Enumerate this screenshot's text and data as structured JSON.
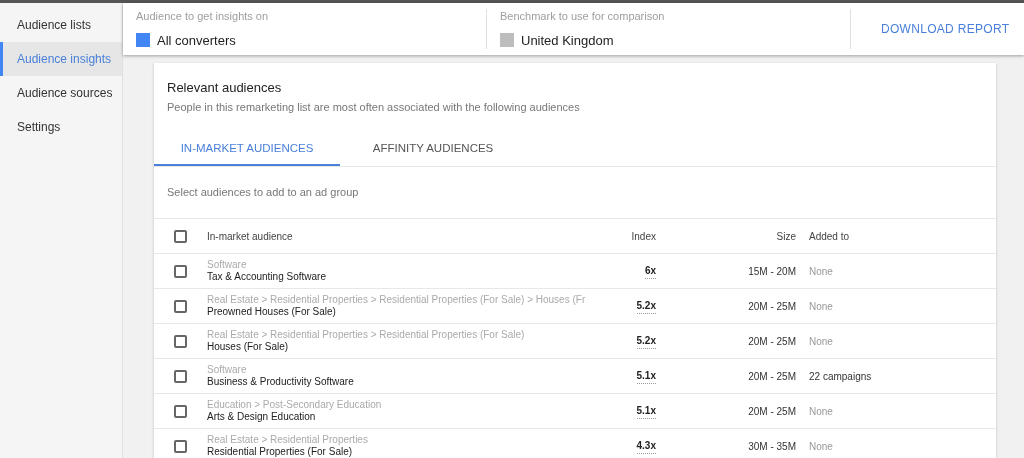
{
  "sidebar": {
    "items": [
      {
        "label": "Audience lists",
        "selected": false
      },
      {
        "label": "Audience insights",
        "selected": true
      },
      {
        "label": "Audience sources",
        "selected": false
      },
      {
        "label": "Settings",
        "selected": false
      }
    ]
  },
  "top_bar": {
    "fields": [
      {
        "label": "Audience to get insights on",
        "value": "All converters",
        "color": "#4285f4"
      },
      {
        "label": "Benchmark to use for comparison",
        "value": "United Kingdom",
        "color": "#bdbdbd"
      }
    ],
    "action": "DOWNLOAD REPORT"
  },
  "card": {
    "title": "Relevant audiences",
    "subtitle": "People in this remarketing list are most often associated with the following audiences",
    "tabs": [
      {
        "label": "IN-MARKET AUDIENCES",
        "selected": true
      },
      {
        "label": "AFFINITY AUDIENCES",
        "selected": false
      }
    ],
    "hint": "Select audiences to add to an ad group",
    "table": {
      "header_checked": false,
      "columns": [
        "In-market audience",
        "Index",
        "Size",
        "Added to"
      ],
      "rows": [
        {
          "checked": false,
          "path": "Software",
          "name": "Tax & Accounting Software",
          "index": "6x",
          "size": "15M - 20M",
          "added_to": "None",
          "added_muted": true
        },
        {
          "checked": false,
          "path": "Real Estate > Residential Properties > Residential Properties (For Sale) > Houses (Fr",
          "name": "Preowned Houses (For Sale)",
          "index": "5.2x",
          "size": "20M - 25M",
          "added_to": "None",
          "added_muted": true
        },
        {
          "checked": false,
          "path": "Real Estate > Residential Properties > Residential Properties (For Sale)",
          "name": "Houses (For Sale)",
          "index": "5.2x",
          "size": "20M - 25M",
          "added_to": "None",
          "added_muted": true
        },
        {
          "checked": false,
          "path": "Software",
          "name": "Business & Productivity Software",
          "index": "5.1x",
          "size": "20M - 25M",
          "added_to": "22 campaigns",
          "added_muted": false
        },
        {
          "checked": false,
          "path": "Education > Post-Secondary Education",
          "name": "Arts & Design Education",
          "index": "5.1x",
          "size": "20M - 25M",
          "added_to": "None",
          "added_muted": true
        },
        {
          "checked": false,
          "path": "Real Estate > Residential Properties",
          "name": "Residential Properties (For Sale)",
          "index": "4.3x",
          "size": "30M - 35M",
          "added_to": "None",
          "added_muted": true
        }
      ]
    }
  }
}
